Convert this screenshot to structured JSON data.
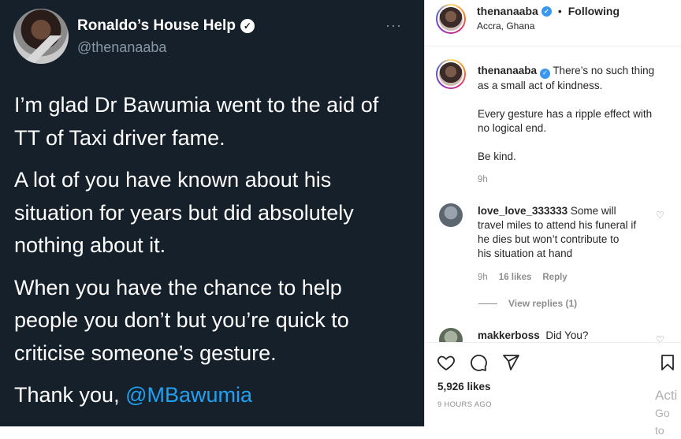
{
  "tweet": {
    "display_name": "Ronaldo’s House Help",
    "handle": "@thenanaaba",
    "paragraphs": [
      "I’m glad Dr Bawumia went to the aid of TT of Taxi driver fame.",
      "A lot of you have known about his situation for years but did absolutely nothing about it.",
      "When you have the chance to help people you don’t but you’re quick to criticise someone’s gesture."
    ],
    "closing_text": "Thank you, ",
    "closing_mention": "@MBawumia",
    "more_glyph": "···"
  },
  "instagram": {
    "header": {
      "username": "thenanaaba",
      "separator": "•",
      "follow_status": "Following",
      "location": "Accra, Ghana"
    },
    "caption": {
      "username": "thenanaaba",
      "lines": [
        "There’s no such thing",
        "as a small act of kindness.",
        "",
        "Every gesture has a ripple effect with",
        "no logical end.",
        "",
        "Be kind."
      ],
      "time": "9h"
    },
    "comments": [
      {
        "username": "love_love_333333",
        "text_lines": [
          "Some will",
          "travel miles to attend his funeral if",
          "he dies but won’t contribute to",
          "his situation at hand"
        ],
        "time": "9h",
        "likes": "16 likes",
        "reply": "Reply",
        "view_replies": "View replies (1)"
      },
      {
        "username": "makkerboss",
        "text_lines": [
          "Did You?"
        ]
      }
    ],
    "likes_count": "5,926 likes",
    "posted_ago": "9 HOURS AGO",
    "icons": {
      "like": "heart-icon",
      "comment": "comment-icon",
      "share": "share-icon",
      "save": "bookmark-icon"
    }
  },
  "watermark": {
    "line1": "Acti",
    "line2": "Go to"
  }
}
